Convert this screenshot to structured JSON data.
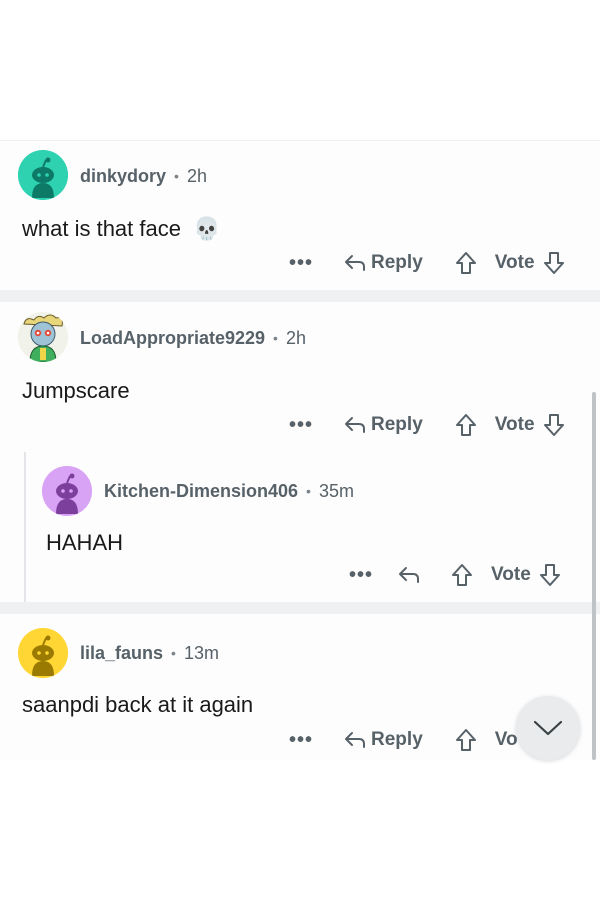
{
  "comments": [
    {
      "username": "dinkydory",
      "time": "2h",
      "body": "what is that face",
      "emoji": "💀",
      "actions": {
        "more": "•••",
        "reply": "Reply",
        "vote": "Vote"
      },
      "avatar_color": "#2ed1b0"
    },
    {
      "username": "LoadAppropriate9229",
      "time": "2h",
      "body": "Jumpscare",
      "actions": {
        "more": "•••",
        "reply": "Reply",
        "vote": "Vote"
      },
      "replies": [
        {
          "username": "Kitchen-Dimension406",
          "time": "35m",
          "body": "HAHAH",
          "actions": {
            "more": "•••",
            "vote": "Vote"
          },
          "avatar_color": "#d8a3f5"
        }
      ]
    },
    {
      "username": "lila_fauns",
      "time": "13m",
      "body": "saanpdi back at it again",
      "actions": {
        "more": "•••",
        "reply": "Reply",
        "vote": "Vo"
      },
      "avatar_color": "#ffd633"
    }
  ],
  "colors": {
    "meta": "#576168",
    "separator": "#eef0f2"
  },
  "icons": [
    "reply-arrow-icon",
    "upvote-icon",
    "downvote-icon",
    "chevron-down-icon"
  ]
}
